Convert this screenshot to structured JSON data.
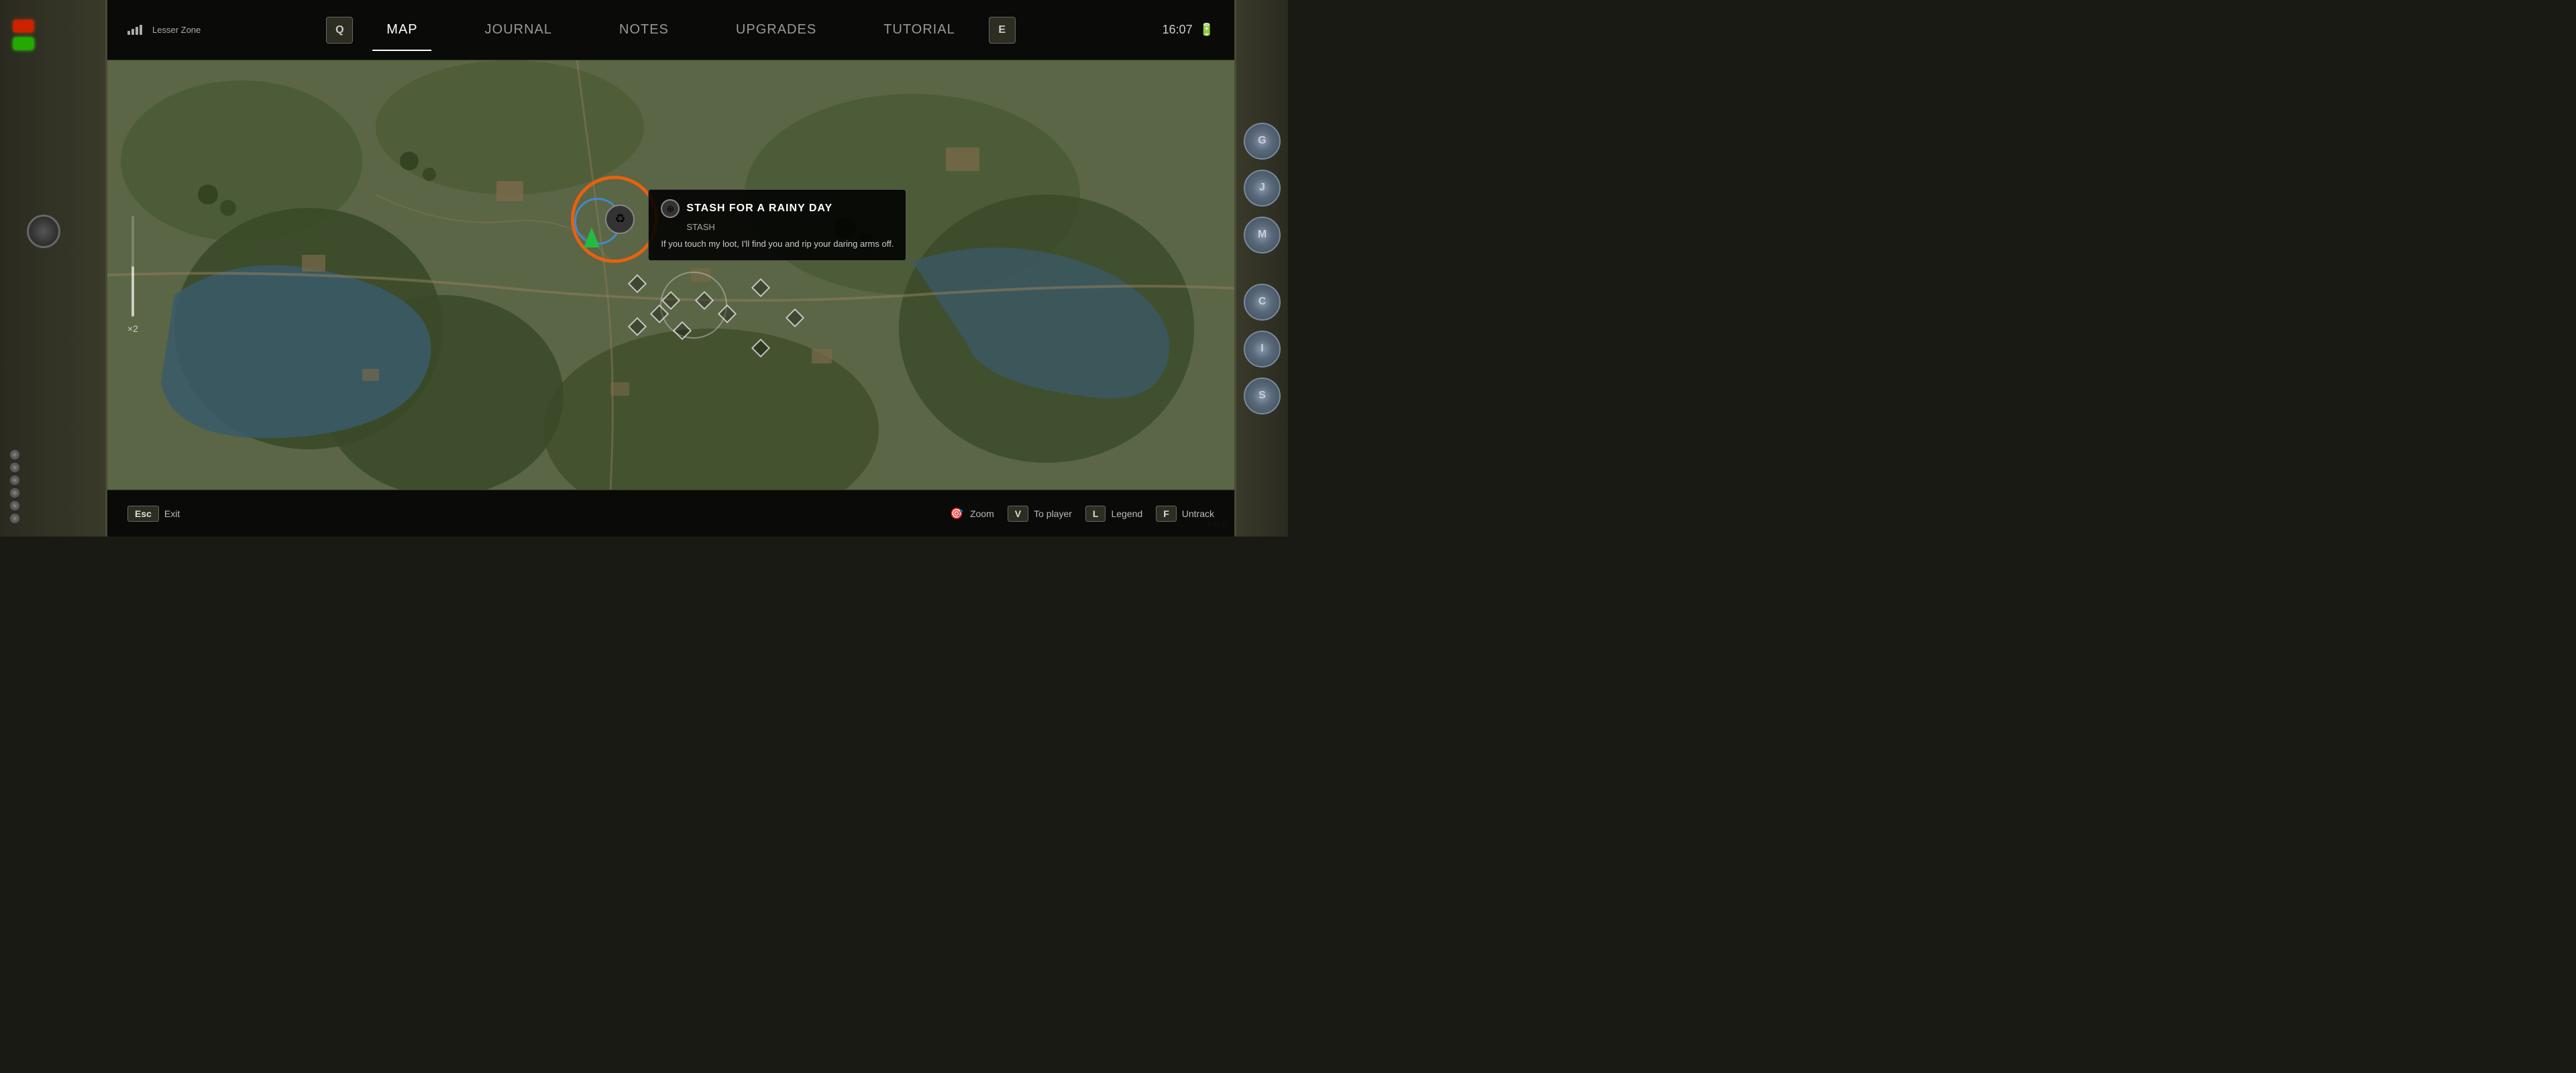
{
  "header": {
    "zone": "Lesser Zone",
    "time": "16:07",
    "tabs": [
      {
        "id": "q-key",
        "label": "Q",
        "type": "key"
      },
      {
        "id": "map",
        "label": "Map",
        "active": true
      },
      {
        "id": "journal",
        "label": "Journal"
      },
      {
        "id": "notes",
        "label": "Notes"
      },
      {
        "id": "upgrades",
        "label": "Upgrades"
      },
      {
        "id": "tutorial",
        "label": "Tutorial"
      },
      {
        "id": "e-key",
        "label": "E",
        "type": "key"
      }
    ]
  },
  "map": {
    "zoom_level": "×2",
    "quest_tooltip": {
      "title": "STASH FOR A RAINY DAY",
      "subtitle": "STASH",
      "description": "If you touch my loot, I'll find you and rip your daring arms off."
    }
  },
  "bottom_bar": {
    "exit_key": "Esc",
    "exit_label": "Exit",
    "hints": [
      {
        "key": "",
        "icon": "🎯",
        "label": "Zoom"
      },
      {
        "key": "V",
        "label": "To player"
      },
      {
        "key": "L",
        "label": "Legend"
      },
      {
        "key": "F",
        "label": "Untrack"
      }
    ]
  },
  "right_buttons": [
    "G",
    "J",
    "M",
    "C",
    "I",
    "S"
  ],
  "watermark": "THE GAMER"
}
